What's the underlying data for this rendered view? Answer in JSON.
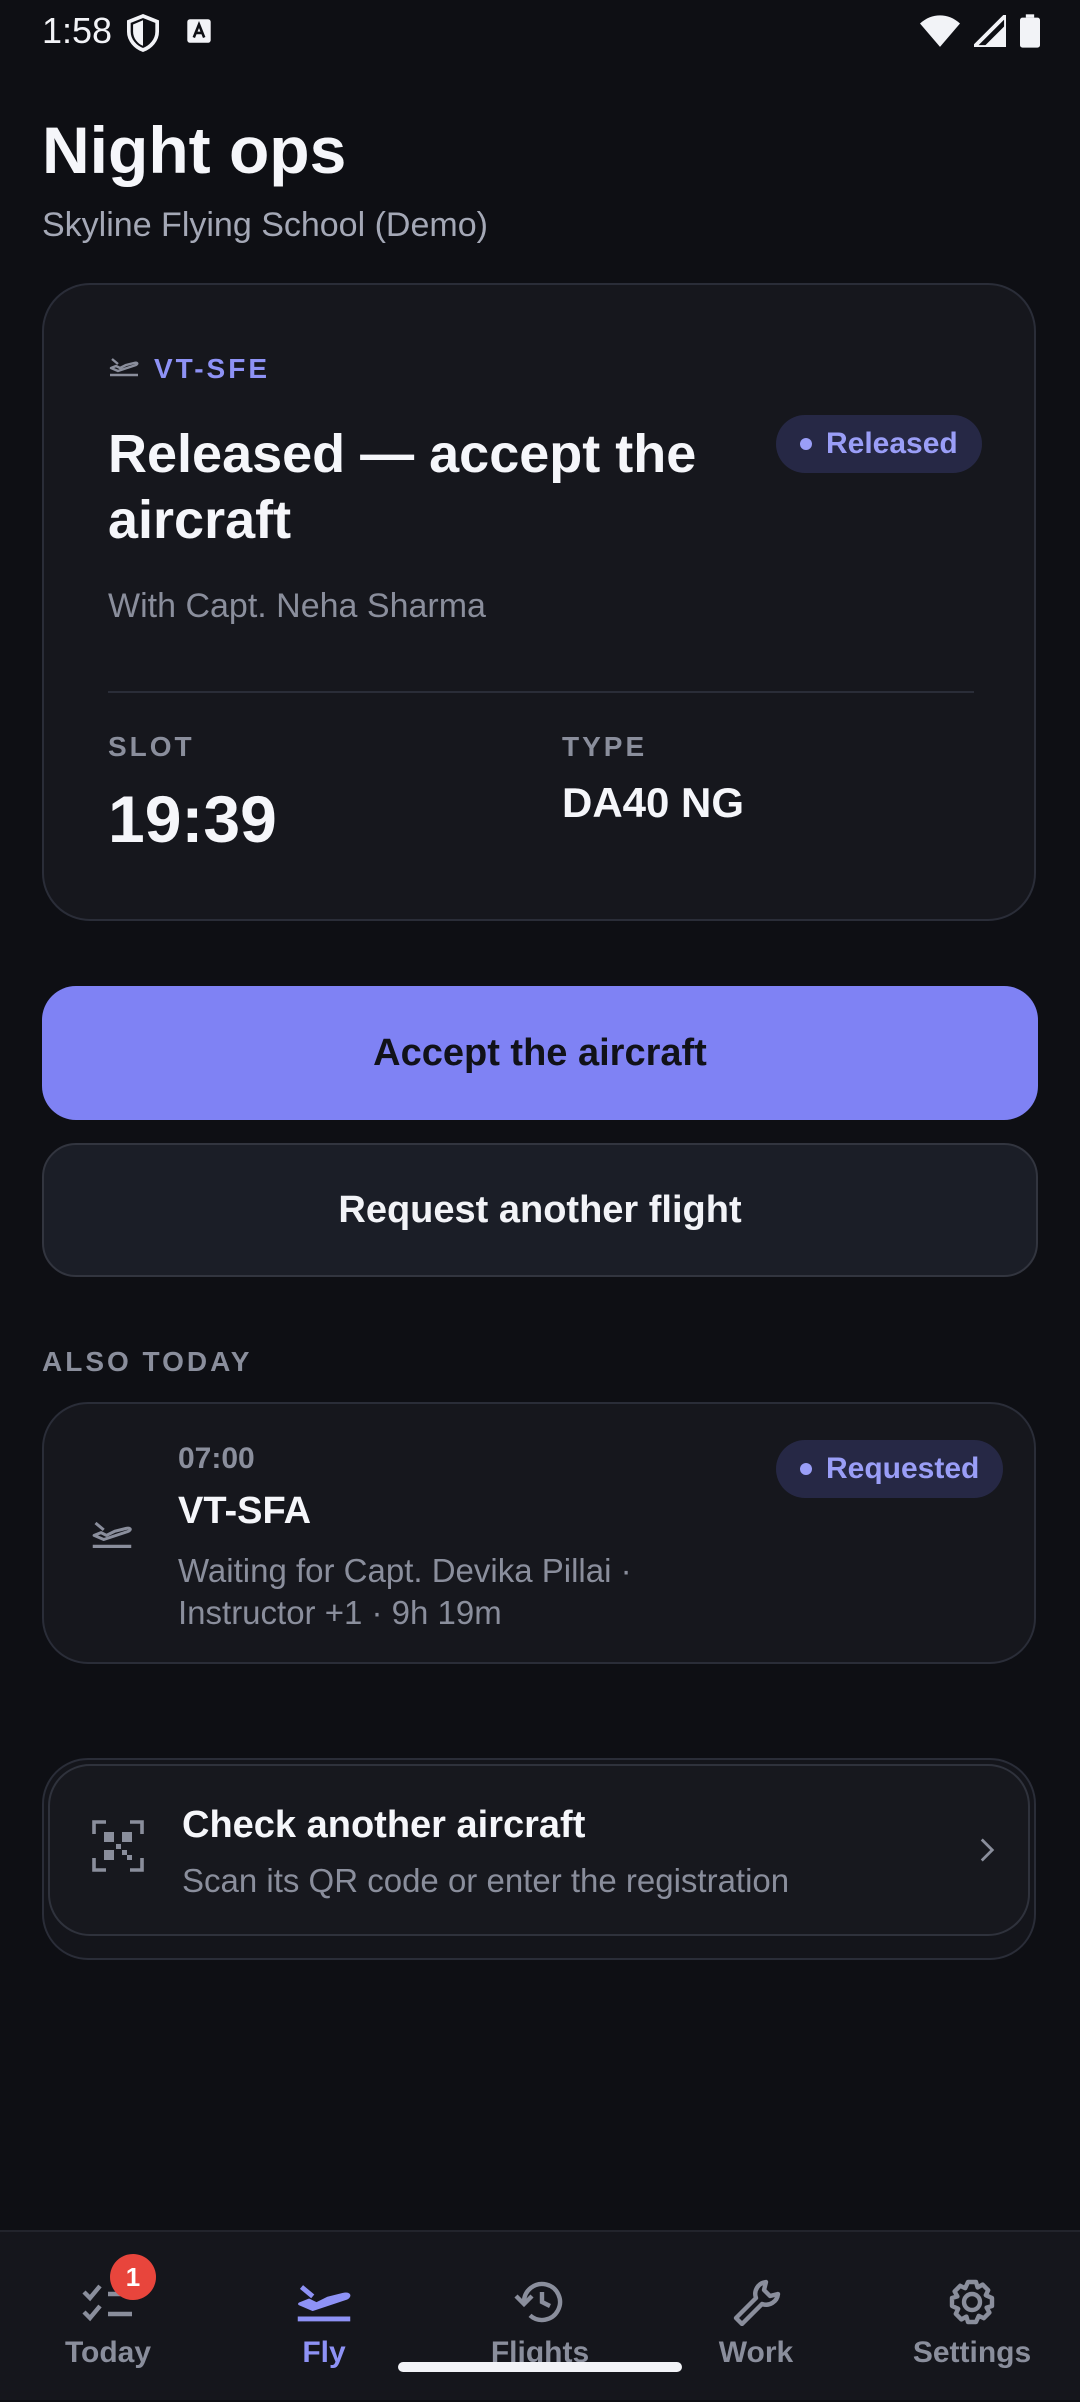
{
  "status_bar": {
    "time": "1:58"
  },
  "header": {
    "title": "Night ops",
    "subtitle": "Skyline Flying School (Demo)"
  },
  "current_flight": {
    "registration": "VT-SFE",
    "heading": "Released — accept the aircraft",
    "status": "Released",
    "instructor": "With Capt. Neha Sharma",
    "slot_label": "SLOT",
    "slot_value": "19:39",
    "type_label": "TYPE",
    "type_value": "DA40 NG"
  },
  "actions": {
    "primary": "Accept the aircraft",
    "secondary": "Request another flight"
  },
  "also_today": {
    "label": "ALSO TODAY",
    "items": [
      {
        "time": "07:00",
        "registration": "VT-SFA",
        "status": "Requested",
        "description": "Waiting for Capt. Devika Pillai · Instructor +1 · 9h 19m"
      }
    ]
  },
  "check_aircraft": {
    "title": "Check another aircraft",
    "subtitle": "Scan its QR code or enter the registration"
  },
  "bottom_nav": {
    "items": [
      {
        "label": "Today",
        "badge": "1"
      },
      {
        "label": "Fly"
      },
      {
        "label": "Flights"
      },
      {
        "label": "Work"
      },
      {
        "label": "Settings"
      }
    ],
    "active": "Fly"
  },
  "colors": {
    "background": "#0e0f14",
    "accent": "#7f82f4",
    "badge_red": "#e8453c"
  }
}
